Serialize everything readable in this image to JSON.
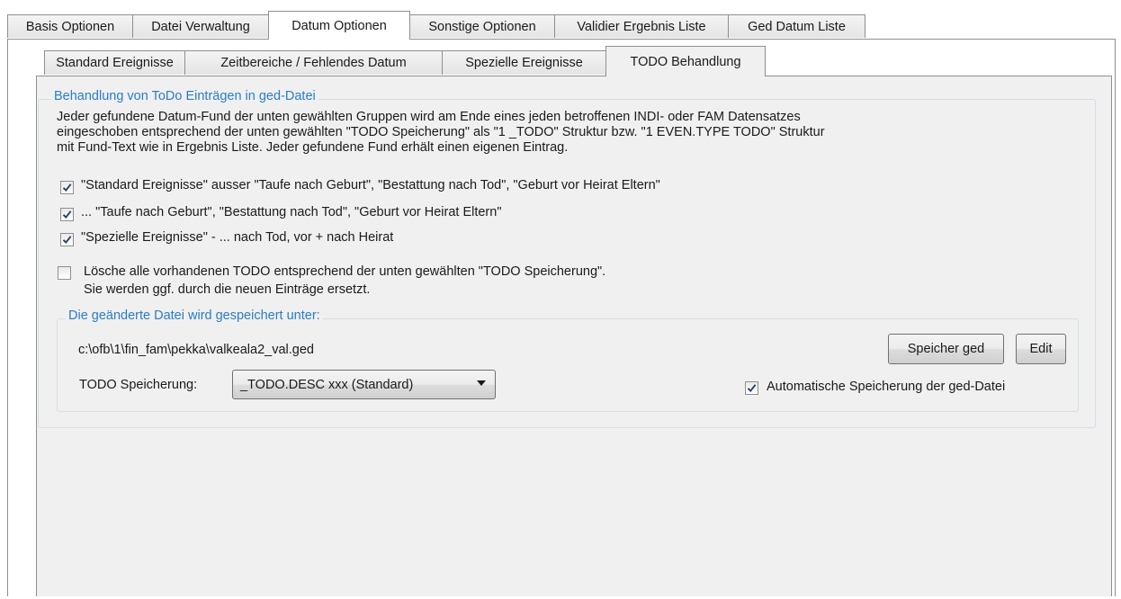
{
  "main_tabs": [
    "Basis Optionen",
    "Datei Verwaltung",
    "Datum Optionen",
    "Sonstige Optionen",
    "Validier Ergebnis Liste",
    "Ged Datum Liste"
  ],
  "sub_tabs": [
    "Standard Ereignisse",
    "Zeitbereiche / Fehlendes Datum",
    "Spezielle Ereignisse",
    "TODO Behandlung"
  ],
  "todo_group": {
    "title": "Behandlung von ToDo Einträgen in ged-Datei",
    "description_lines": [
      "Jeder gefundene Datum-Fund der unten gewählten Gruppen wird am Ende eines jeden betroffenen INDI- oder FAM Datensatzes",
      "eingeschoben entsprechend der unten gewählten \"TODO Speicherung\" als \"1 _TODO\" Struktur bzw. \"1 EVEN.TYPE TODO\" Struktur",
      "mit Fund-Text wie in Ergebnis Liste. Jeder gefundene Fund erhält einen eigenen Eintrag."
    ],
    "checkboxes": [
      {
        "label": "\"Standard Ereignisse\" ausser \"Taufe nach Geburt\", \"Bestattung nach Tod\", \"Geburt vor Heirat Eltern\"",
        "checked": true
      },
      {
        "label": "... \"Taufe nach Geburt\", \"Bestattung nach Tod\", \"Geburt vor Heirat Eltern\"",
        "checked": true
      },
      {
        "label": "\"Spezielle Ereignisse\" - ... nach Tod, vor + nach Heirat",
        "checked": true
      }
    ],
    "delete_option": {
      "line1": "Lösche alle vorhandenen TODO entsprechend der unten gewählten \"TODO Speicherung\".",
      "line2": "Sie werden ggf. durch die neuen Einträge ersetzt.",
      "checked": false
    }
  },
  "save_group": {
    "title": "Die geänderte Datei wird gespeichert unter:",
    "path": "c:\\ofb\\1\\fin_fam\\pekka\\valkeala2_val.ged",
    "save_button": "Speicher ged",
    "edit_button": "Edit",
    "todo_label": "TODO Speicherung:",
    "todo_value": "_TODO.DESC xxx (Standard)",
    "auto_save_label": "Automatische Speicherung der ged-Datei",
    "auto_save_checked": true
  }
}
